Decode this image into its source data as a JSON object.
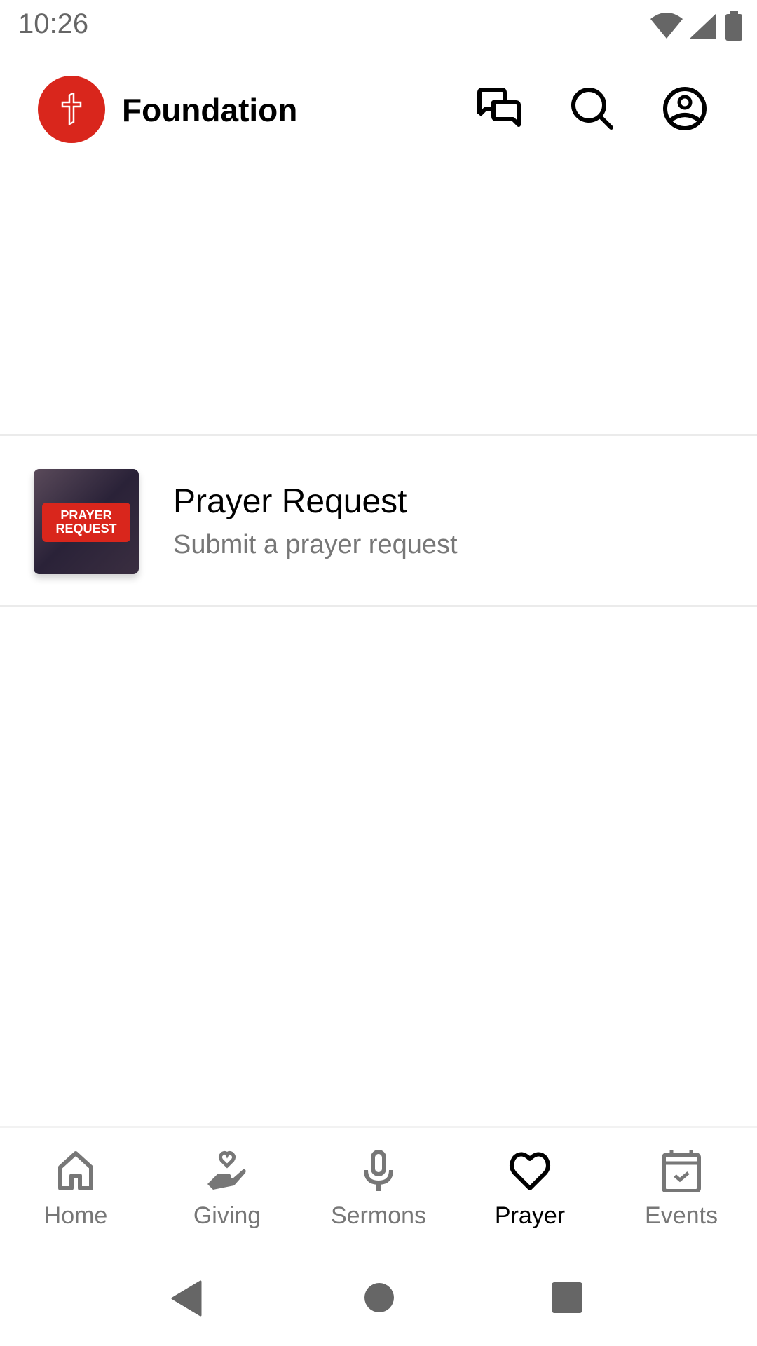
{
  "status_bar": {
    "time": "10:26",
    "icons": [
      "wifi-icon",
      "cellular-signal-icon",
      "battery-icon"
    ]
  },
  "app_bar": {
    "title": "Foundation",
    "logo_icon": "cross-logo-icon",
    "actions": [
      "chat-icon",
      "search-icon",
      "account-icon"
    ]
  },
  "list": {
    "items": [
      {
        "title": "Prayer Request",
        "subtitle": "Submit a prayer request",
        "thumbnail_text": "PRAYER REQUEST"
      }
    ]
  },
  "bottom_nav": {
    "items": [
      {
        "label": "Home",
        "icon": "home-icon",
        "active": false
      },
      {
        "label": "Giving",
        "icon": "giving-hand-heart-icon",
        "active": false
      },
      {
        "label": "Sermons",
        "icon": "microphone-icon",
        "active": false
      },
      {
        "label": "Prayer",
        "icon": "heart-icon",
        "active": true
      },
      {
        "label": "Events",
        "icon": "calendar-check-icon",
        "active": false
      }
    ]
  },
  "colors": {
    "brand": "#d9261c",
    "inactive": "#777777",
    "active": "#000000"
  }
}
